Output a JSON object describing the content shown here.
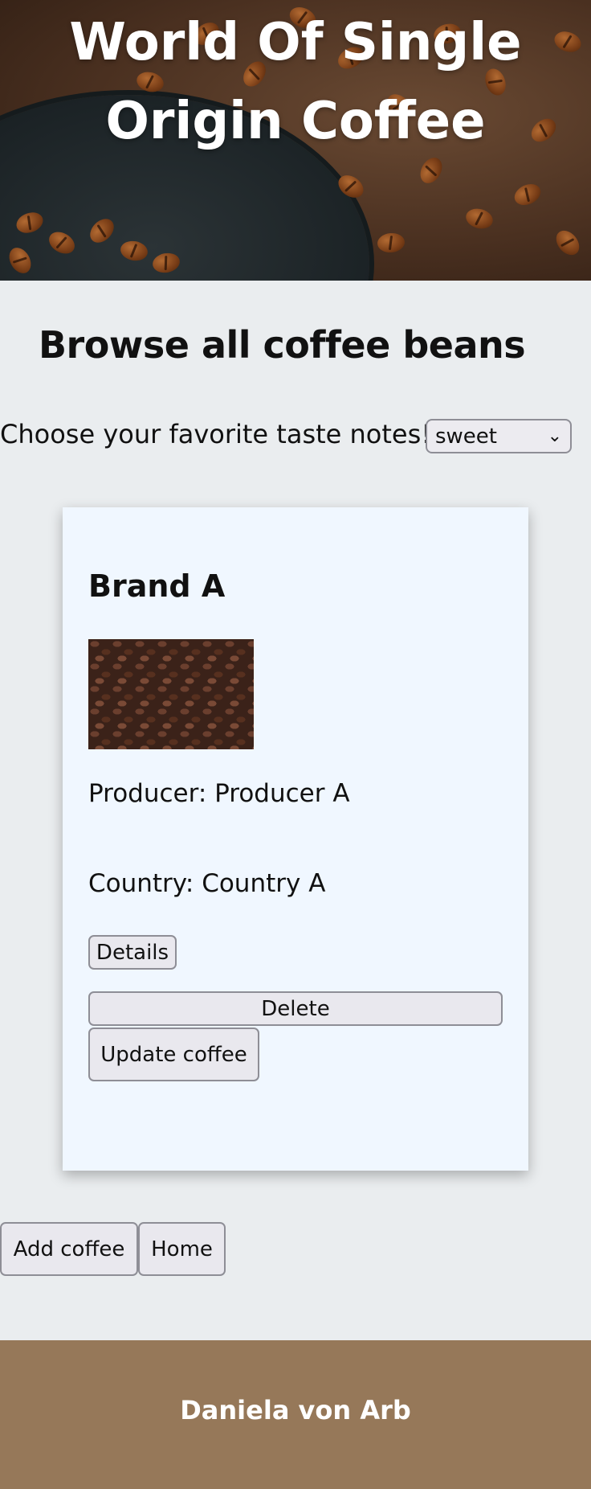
{
  "hero": {
    "title": "World Of Single Origin Coffee"
  },
  "browse": {
    "title": "Browse all coffee beans",
    "filter_label": "Choose your favorite taste notes!",
    "filter_selected": "sweet"
  },
  "card": {
    "brand": "Brand A",
    "producer": "Producer: Producer A",
    "country": "Country: Country A",
    "details_label": "Details",
    "delete_label": "Delete",
    "update_label": "Update coffee"
  },
  "actions": {
    "add_label": "Add coffee",
    "home_label": "Home"
  },
  "footer": {
    "name": "Daniela von Arb"
  },
  "icons": {
    "select_arrow": "chevron-down-icon"
  }
}
